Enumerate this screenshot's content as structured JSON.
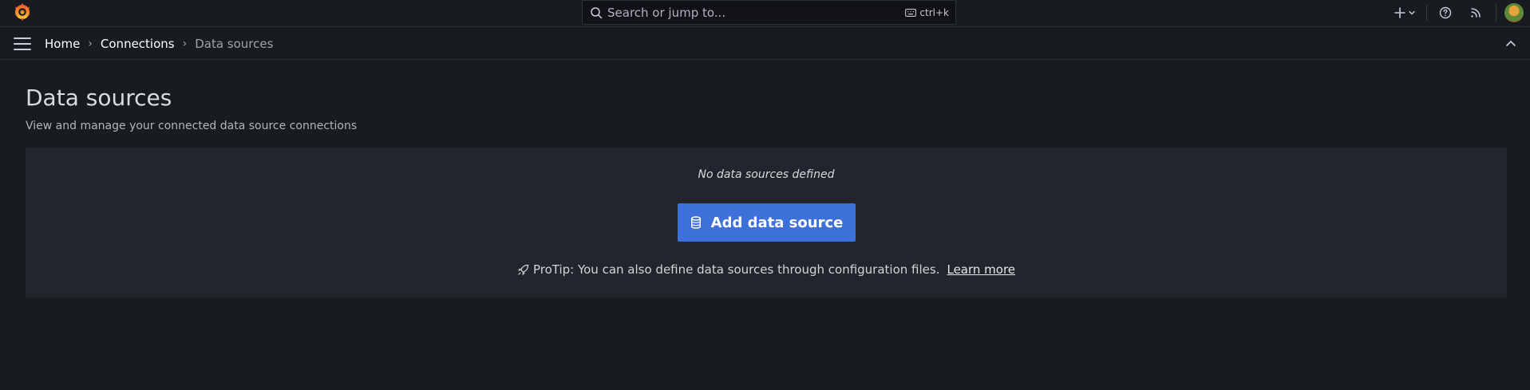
{
  "topbar": {
    "logo_icon": "grafana-logo-icon",
    "search": {
      "placeholder": "Search or jump to...",
      "shortcut": "ctrl+k"
    },
    "icons": [
      "plus-icon",
      "chevron-down-icon",
      "help-icon",
      "rss-icon",
      "avatar"
    ]
  },
  "navbar": {
    "breadcrumb": [
      {
        "label": "Home"
      },
      {
        "label": "Connections"
      },
      {
        "label": "Data sources"
      }
    ]
  },
  "page": {
    "title": "Data sources",
    "subtitle": "View and manage your connected data source connections"
  },
  "empty_state": {
    "message": "No data sources defined",
    "button_label": "Add data source",
    "protip_text": "ProTip: You can also define data sources through configuration files.",
    "protip_link": "Learn more"
  },
  "colors": {
    "background": "#181b1f",
    "card": "#22252b",
    "primary_button": "#3d71d9",
    "logo_accent": "#f05a28"
  }
}
